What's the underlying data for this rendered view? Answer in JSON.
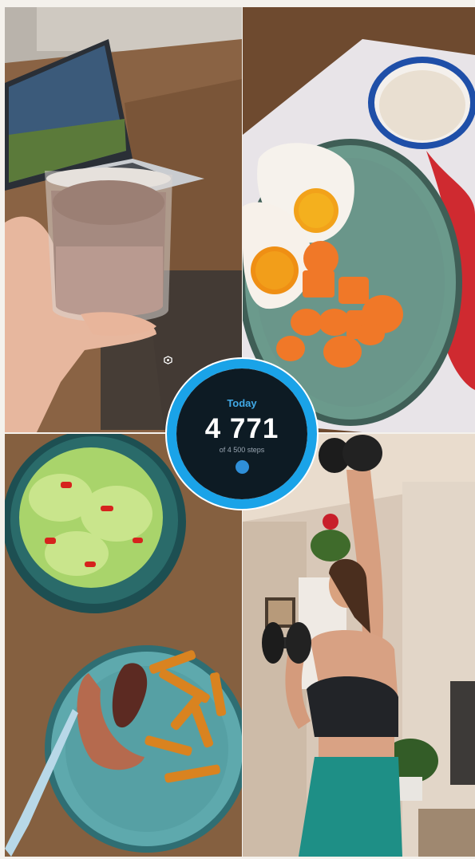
{
  "steps_widget": {
    "label": "Today",
    "count": "4 771",
    "goal_text": "of 4 500 steps",
    "progress_fraction": 1.0,
    "icon": "shield-badge-icon",
    "ring_color": "#1aa3e8",
    "panel_color": "#0d1b24"
  },
  "photos": [
    {
      "name": "protein-shake-photo",
      "subject": "hand holding glass of chocolate shake in front of laptop"
    },
    {
      "name": "eggs-carrots-photo",
      "subject": "fried eggs with carrots on green plate and bowl of porridge"
    },
    {
      "name": "salad-sausage-fries-photo",
      "subject": "green salad bowl and plate with sausage and sweet potato fries"
    },
    {
      "name": "dumbbell-workout-photo",
      "subject": "woman doing overhead dumbbell press in living room"
    }
  ]
}
